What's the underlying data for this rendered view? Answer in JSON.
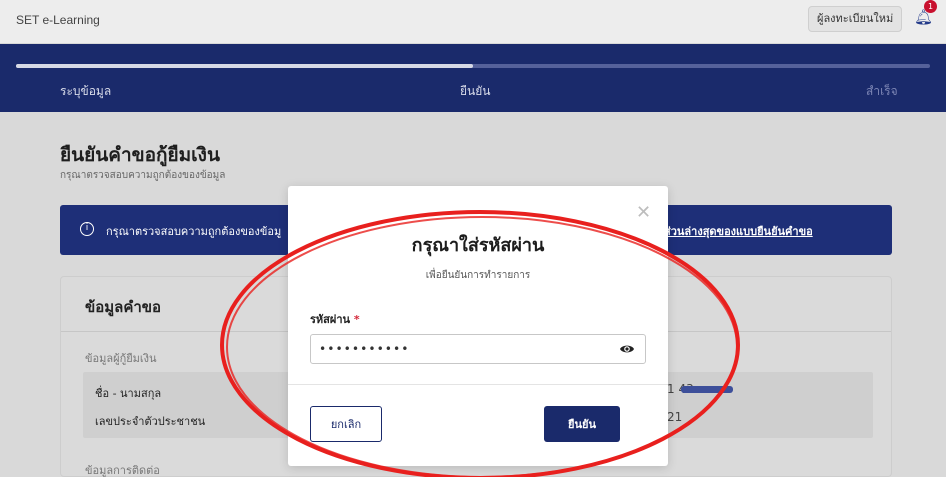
{
  "header": {
    "brand": "SET e-Learning",
    "register_label": "ผู้ลงทะเบียนใหม่",
    "notification_count": "1"
  },
  "stepper": {
    "progress": 0.5,
    "steps": [
      "ระบุข้อมูล",
      "ยืนยัน",
      "สำเร็จ"
    ]
  },
  "page": {
    "title": "ยืนยันคำขอกู้ยืมเงิน",
    "subtitle": "กรุณาตรวจสอบความถูกต้องของข้อมูล"
  },
  "notice": {
    "icon": "info-icon",
    "text": "กรุณาตรวจสอบความถูกต้องของข้อมู",
    "link": "ส่วนล่างสุดของแบบยืนยันคำขอ"
  },
  "card": {
    "title": "ข้อมูลคำขอ",
    "section_borrower": "ข้อมูลผู้กู้ยืมเงิน",
    "rows": [
      {
        "label": "ชื่อ - นามสกุล",
        "value": "1 43"
      },
      {
        "label": "เลขประจำตัวประชาชน",
        "value": "21"
      }
    ],
    "section_contact": "ข้อมูลการติดต่อ"
  },
  "modal": {
    "title": "กรุณาใส่รหัสผ่าน",
    "subtitle": "เพื่อยืนยันการทำรายการ",
    "field_label": "รหัสผ่าน",
    "required_mark": "*",
    "password_value": "•••••••••••",
    "close_icon": "close-icon",
    "eye_icon": "eye-icon",
    "cancel_label": "ยกเลิก",
    "confirm_label": "ยืนยัน"
  },
  "colors": {
    "brand_navy": "#1a2a6b",
    "annotation_red": "#e8201e",
    "required_red": "#d4283a"
  }
}
